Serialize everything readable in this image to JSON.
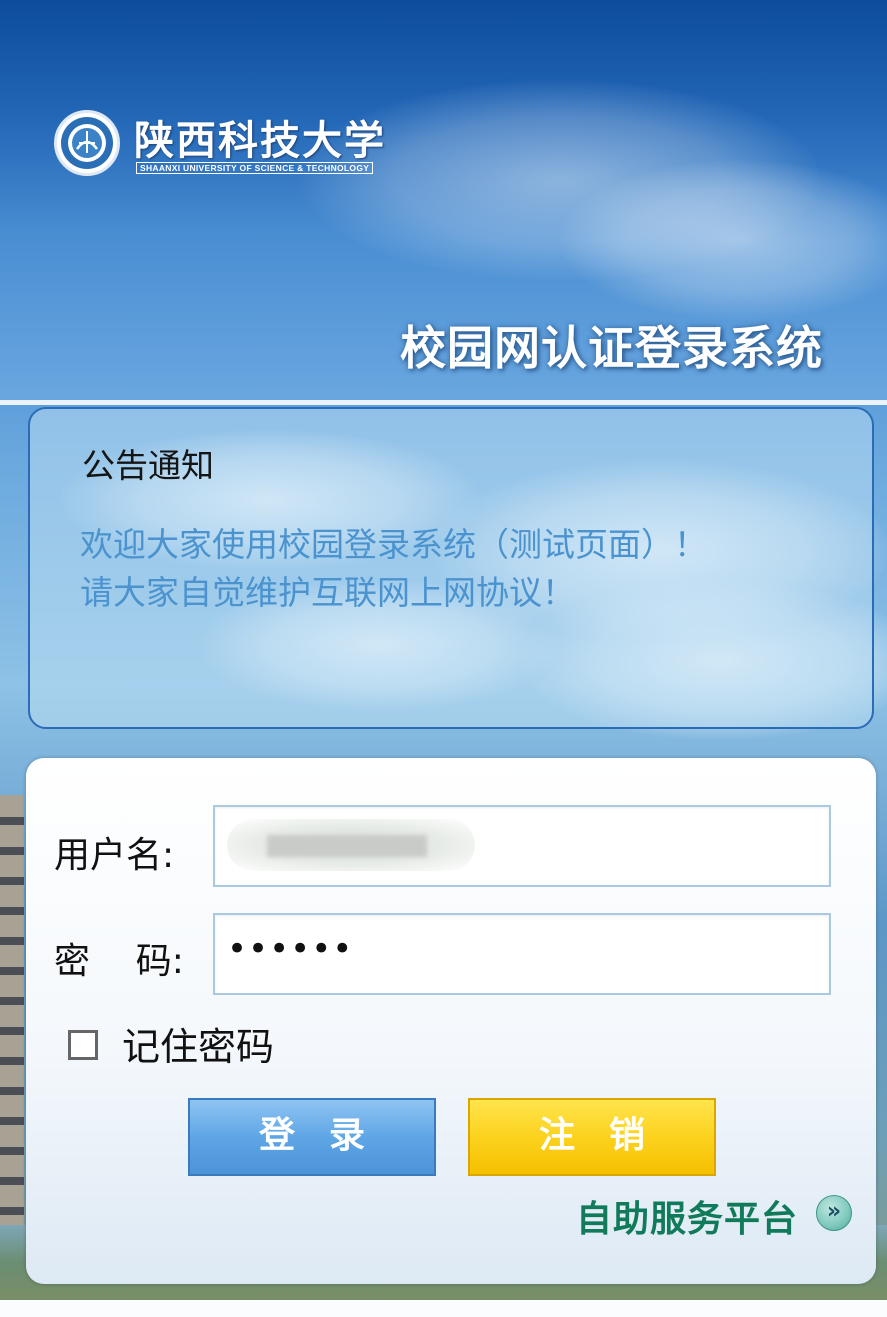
{
  "header": {
    "university_name_zh": "陕西科技大学",
    "university_name_en": "SHAANXI UNIVERSITY OF SCIENCE & TECHNOLOGY",
    "system_title": "校园网认证登录系统"
  },
  "notice": {
    "title": "公告通知",
    "lines": [
      "欢迎大家使用校园登录系统（测试页面）！",
      "请大家自觉维护互联网上网协议！"
    ]
  },
  "login": {
    "username_label": "用户名:",
    "username_value": "",
    "password_label": "密    码:",
    "password_value": "••••••",
    "remember_label": "记住密码",
    "remember_checked": false,
    "login_button": "登录",
    "logout_button": "注销",
    "self_service_link": "自助服务平台",
    "self_service_icon": "»"
  },
  "colors": {
    "header_blue": "#2468b8",
    "notice_text": "#4b93cf",
    "login_button": "#5fa6e6",
    "logout_button": "#fcd21e",
    "self_service_text": "#107a5a"
  },
  "icons": {
    "logo": "university-emblem-icon",
    "self_service": "double-chevron-right-icon"
  }
}
